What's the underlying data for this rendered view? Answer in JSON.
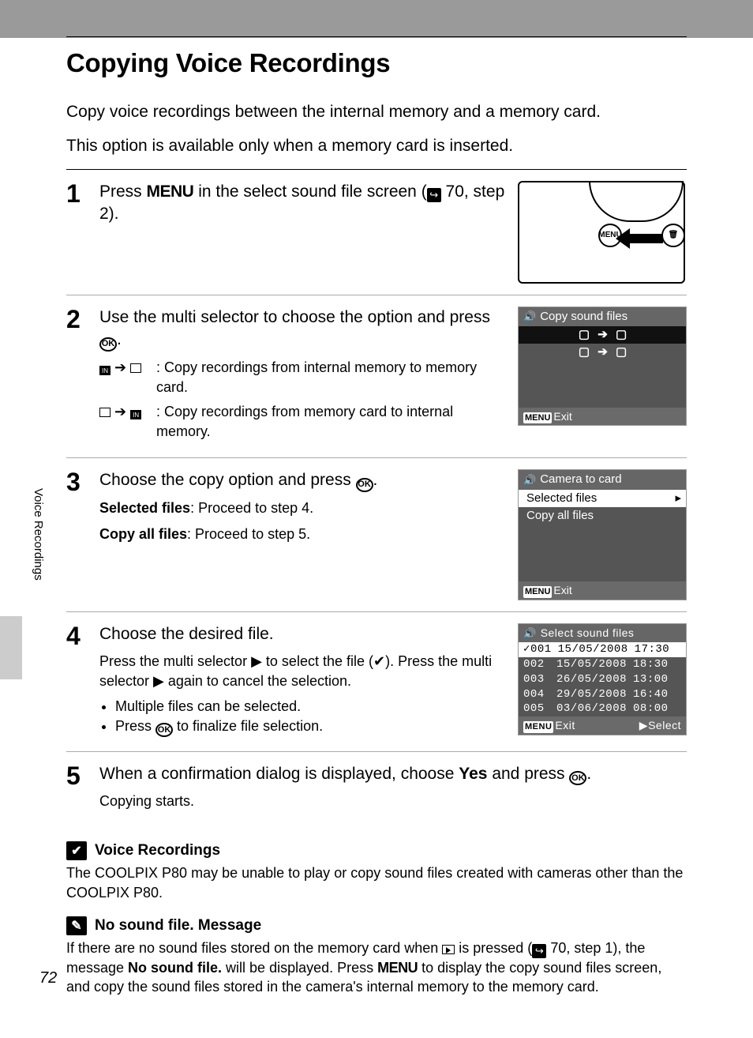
{
  "section_tab": "Voice Recordings",
  "page_number": "72",
  "title": "Copying Voice Recordings",
  "intro_l1": "Copy voice recordings between the internal memory and a memory card.",
  "intro_l2": "This option is available only when a memory card is inserted.",
  "ok_label": "OK",
  "menu_label": "MENU",
  "steps": {
    "s1": {
      "num": "1",
      "pre": "Press ",
      "post": " in the select sound file screen (",
      "ref": " 70, step 2)."
    },
    "s2": {
      "num": "2",
      "head": "Use the multi selector to choose the option and press ",
      "opt1": ": Copy recordings from internal memory to memory card.",
      "opt2": ": Copy recordings from memory card to internal memory.",
      "lcd_title": "Copy sound files",
      "lcd_dir1": "🄸 ➔ ⎘",
      "lcd_dir2": "⎘ ➔ 🄸",
      "lcd_exit": "Exit"
    },
    "s3": {
      "num": "3",
      "head": "Choose the copy option and press ",
      "sel_label": "Selected files",
      "sel_text": ": Proceed to step 4.",
      "all_label": "Copy all files",
      "all_text": ": Proceed to step 5.",
      "lcd_title": "Camera to card",
      "lcd_sel": "Selected files",
      "lcd_all": "Copy all files",
      "lcd_exit": "Exit"
    },
    "s4": {
      "num": "4",
      "head": "Choose the desired file.",
      "p1a": "Press the multi selector ",
      "p1b": " to select the file (",
      "p1c": "). Press the multi selector ",
      "p1d": " again to cancel the selection.",
      "b1": "Multiple files can be selected.",
      "b2a": "Press ",
      "b2b": " to finalize file selection.",
      "lcd_title": "Select sound files",
      "files": [
        [
          "001",
          "15/05/2008",
          "17:30"
        ],
        [
          "002",
          "15/05/2008",
          "18:30"
        ],
        [
          "003",
          "26/05/2008",
          "13:00"
        ],
        [
          "004",
          "29/05/2008",
          "16:40"
        ],
        [
          "005",
          "03/06/2008",
          "08:00"
        ]
      ],
      "lcd_exit": "Exit",
      "lcd_select": "Select"
    },
    "s5": {
      "num": "5",
      "head_a": "When a confirmation dialog is displayed, choose ",
      "head_yes": "Yes",
      "head_b": " and press ",
      "p": "Copying starts."
    }
  },
  "note1": {
    "title": "Voice Recordings",
    "body": "The COOLPIX P80 may be unable to play or copy sound files created with cameras other than the COOLPIX P80."
  },
  "note2": {
    "title": "No sound file. Message",
    "body_a": "If there are no sound files stored on the memory card when ",
    "body_b": " is pressed (",
    "body_ref": " 70, step 1), the message ",
    "body_msg": "No sound file.",
    "body_c": " will be displayed. Press ",
    "body_d": " to display the copy sound files screen, and copy the sound files stored in the camera's internal memory to the memory card."
  }
}
